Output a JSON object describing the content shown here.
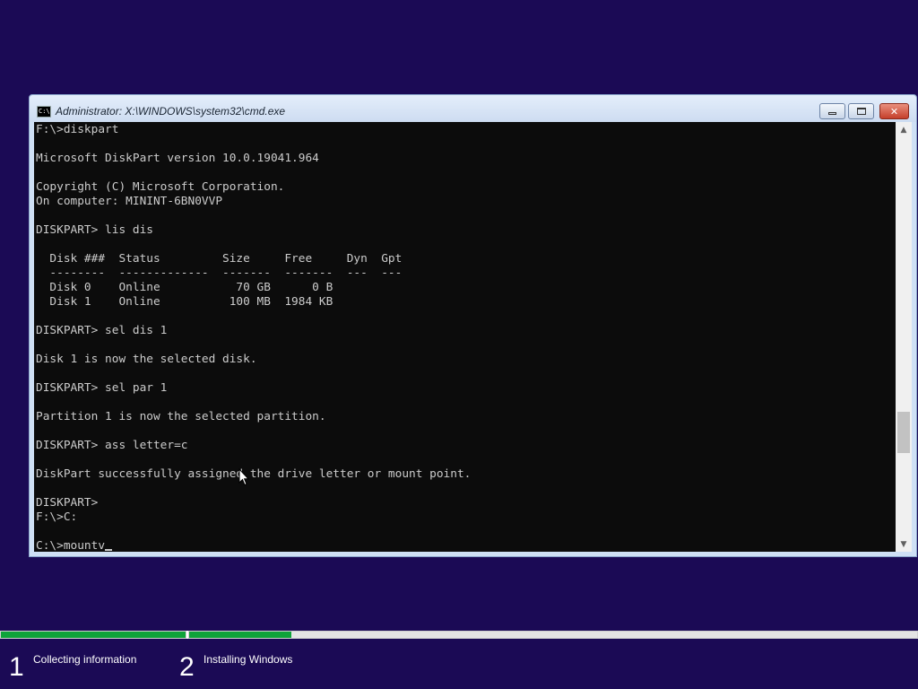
{
  "window": {
    "title": "Administrator: X:\\WINDOWS\\system32\\cmd.exe",
    "icon_text": "C:\\",
    "icon": "console-app-icon",
    "minimize": "–",
    "maximize": "□",
    "close": "✕"
  },
  "console": {
    "lines": [
      "F:\\>diskpart",
      "",
      "Microsoft DiskPart version 10.0.19041.964",
      "",
      "Copyright (C) Microsoft Corporation.",
      "On computer: MININT-6BN0VVP",
      "",
      "DISKPART> lis dis",
      "",
      "  Disk ###  Status         Size     Free     Dyn  Gpt",
      "  --------  -------------  -------  -------  ---  ---",
      "  Disk 0    Online           70 GB      0 B",
      "  Disk 1    Online          100 MB  1984 KB",
      "",
      "DISKPART> sel dis 1",
      "",
      "Disk 1 is now the selected disk.",
      "",
      "DISKPART> sel par 1",
      "",
      "Partition 1 is now the selected partition.",
      "",
      "DISKPART> ass letter=c",
      "",
      "DiskPart successfully assigned the drive letter or mount point.",
      "",
      "DISKPART>",
      "F:\\>C:",
      "",
      "C:\\>mountv"
    ]
  },
  "scrollbar": {
    "up_arrow": "▲",
    "down_arrow": "▼"
  },
  "setup": {
    "progress": [
      {
        "name": "Collecting information",
        "fraction": 1.0
      },
      {
        "name": "Installing Windows",
        "fraction": 0.14
      }
    ],
    "steps": [
      {
        "number": "1",
        "label": "Collecting information"
      },
      {
        "number": "2",
        "label": "Installing Windows"
      }
    ]
  },
  "colors": {
    "desktop": "#1b0a55",
    "console_bg": "#0c0c0c",
    "console_text": "#cccccc",
    "progress_green": "#0fa33a"
  }
}
